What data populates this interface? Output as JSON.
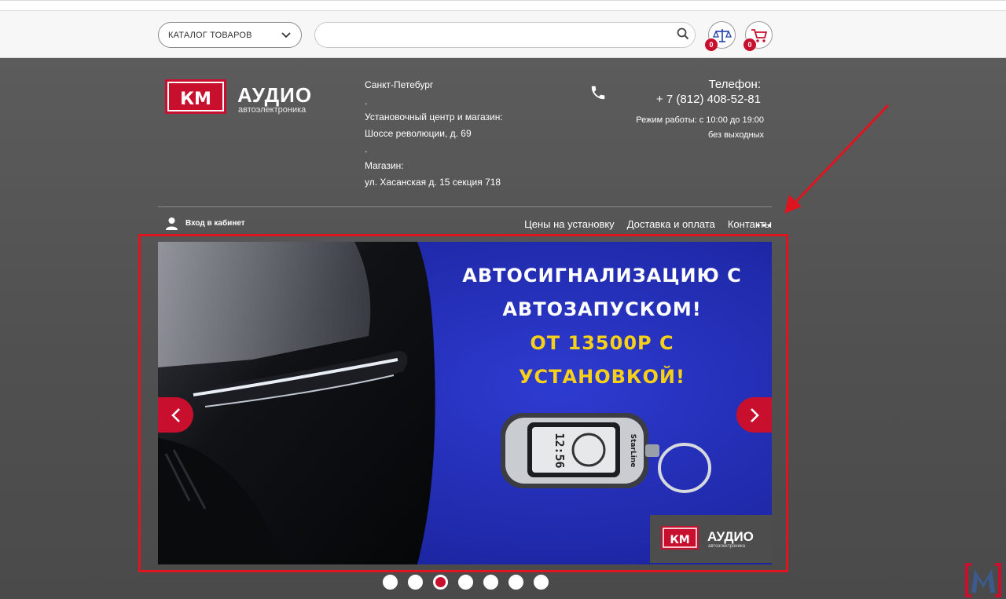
{
  "topbar": {
    "catalog_label": "КАТАЛОГ ТОВАРОВ",
    "search_value": "",
    "compare_count": "0",
    "cart_count": "0"
  },
  "brand": {
    "logo_mark": "КМ",
    "name": "АУДИО",
    "subtitle": "автоэлектроника"
  },
  "address": {
    "lines": [
      "Санкт-Петебург",
      ".",
      "Установочный центр и магазин:",
      "Шоссе революции, д. 69",
      ".",
      "Магазин:",
      "ул. Хасанская д. 15 секция 718"
    ]
  },
  "contact": {
    "phone_label": "Телефон:",
    "phone_number": "+ 7 (812) 408-52-81",
    "hours_line1": "Режим работы: с 10:00 до 19:00",
    "hours_line2": "без выходных"
  },
  "account": {
    "login_label": "Вход в кабинет"
  },
  "nav": {
    "items": [
      "Цены на установку",
      "Доставка и оплата",
      "Контакты"
    ]
  },
  "slider": {
    "line1": "АВТОСИГНАЛИЗАЦИЮ С",
    "line2": "АВТОЗАПУСКОМ!",
    "line3": "ОТ 13500Р С",
    "line4": "УСТАНОВКОЙ!",
    "keyfob_time": "12:56",
    "keyfob_brand": "StarLine",
    "mini_logo_mark": "КМ",
    "mini_logo_name": "АУДИО",
    "mini_logo_sub": "автоэлектроника",
    "slide_count": 7,
    "active_slide": 3
  },
  "colors": {
    "accent": "#c8102e",
    "banner_blue": "#1f2aa8",
    "promo_yellow": "#f7d117",
    "annotation_red": "#e0141e"
  }
}
